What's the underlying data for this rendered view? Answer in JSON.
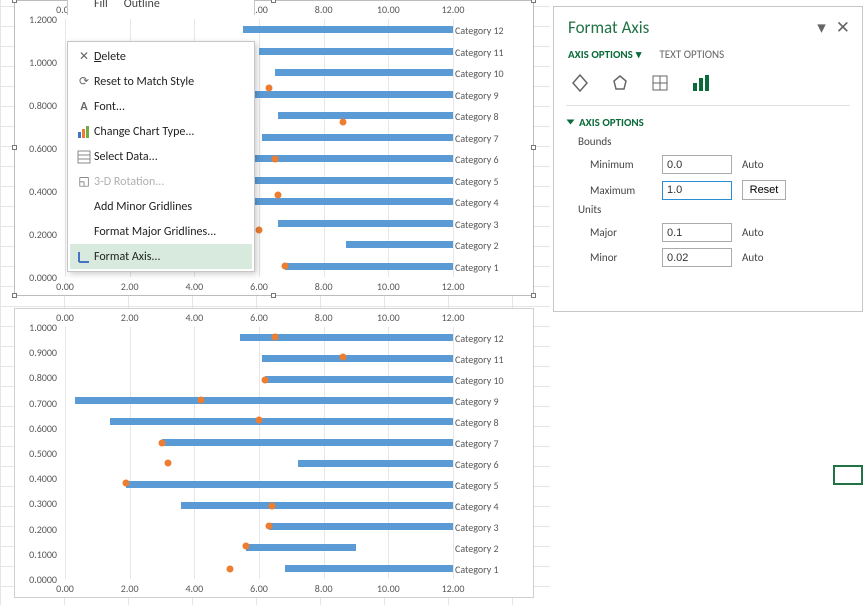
{
  "pane": {
    "title": "Format Axis",
    "tab_axis_options": "AXIS OPTIONS",
    "tab_text_options": "TEXT OPTIONS",
    "section": "AXIS OPTIONS",
    "bounds_label": "Bounds",
    "min_label": "Minimum",
    "min_value": "0.0",
    "min_btn": "Auto",
    "max_label": "Maximum",
    "max_value": "1.0",
    "max_btn": "Reset",
    "units_label": "Units",
    "major_label": "Major",
    "major_value": "0.1",
    "major_btn": "Auto",
    "minor_label": "Minor",
    "minor_value": "0.02",
    "minor_btn": "Auto"
  },
  "mini_toolbar": {
    "fill": "Fill",
    "outline": "Outline"
  },
  "context_menu": {
    "delete": "Delete",
    "reset": "Reset to Match Style",
    "font": "Font...",
    "change_type": "Change Chart Type...",
    "select_data": "Select Data...",
    "rotation": "3-D Rotation...",
    "add_minor": "Add Minor Gridlines",
    "format_major": "Format Major Gridlines...",
    "format_axis": "Format Axis..."
  },
  "chart_data": [
    {
      "type": "bar",
      "title": "",
      "xlabel": "",
      "ylabel": "",
      "x_range": [
        0,
        12
      ],
      "x_ticks": [
        0,
        2,
        4,
        6,
        8,
        10,
        12
      ],
      "x_tick_labels": [
        "0.00",
        "2.00",
        "4.00",
        "6.00",
        "8.00",
        "10.00",
        "12.00"
      ],
      "y_range": [
        0,
        1.2
      ],
      "y_ticks": [
        0,
        0.2,
        0.4,
        0.6,
        0.8,
        1.0,
        1.2
      ],
      "y_tick_labels": [
        "0.0000",
        "0.2000",
        "0.4000",
        "0.6000",
        "0.8000",
        "1.0000",
        "1.2000"
      ],
      "categories": [
        "Category 1",
        "Category 2",
        "Category 3",
        "Category 4",
        "Category 5",
        "Category 6",
        "Category 7",
        "Category 8",
        "Category 9",
        "Category 10",
        "Category 11",
        "Category 12"
      ],
      "bars": [
        {
          "start": 6.8,
          "end": 12.0
        },
        {
          "start": 8.7,
          "end": 12.0
        },
        {
          "start": 6.6,
          "end": 12.0
        },
        {
          "start": 5.8,
          "end": 12.0
        },
        {
          "start": 5.6,
          "end": 12.0
        },
        {
          "start": 5.4,
          "end": 12.0
        },
        {
          "start": 6.1,
          "end": 12.0
        },
        {
          "start": 6.6,
          "end": 12.0
        },
        {
          "start": 0.5,
          "end": 12.0
        },
        {
          "start": 6.5,
          "end": 12.0
        },
        {
          "start": 6.0,
          "end": 12.0
        },
        {
          "start": 5.5,
          "end": 12.0
        }
      ],
      "dots": [
        {
          "x": 6.8,
          "y": 0.05
        },
        {
          "x": 6.0,
          "y": 0.22
        },
        {
          "x": 6.6,
          "y": 0.38
        },
        {
          "x": 6.5,
          "y": 0.55
        },
        {
          "x": 8.6,
          "y": 0.72
        },
        {
          "x": 6.3,
          "y": 0.88
        }
      ]
    },
    {
      "type": "bar",
      "title": "",
      "xlabel": "",
      "ylabel": "",
      "x_range": [
        0,
        12
      ],
      "x_ticks": [
        0,
        2,
        4,
        6,
        8,
        10,
        12
      ],
      "x_tick_labels": [
        "0.00",
        "2.00",
        "4.00",
        "6.00",
        "8.00",
        "10.00",
        "12.00"
      ],
      "y_range": [
        0,
        1.0
      ],
      "y_ticks": [
        0,
        0.1,
        0.2,
        0.3,
        0.4,
        0.5,
        0.6,
        0.7,
        0.8,
        0.9,
        1.0
      ],
      "y_tick_labels": [
        "0.0000",
        "0.1000",
        "0.2000",
        "0.3000",
        "0.4000",
        "0.5000",
        "0.6000",
        "0.7000",
        "0.8000",
        "0.9000",
        "1.0000"
      ],
      "categories": [
        "Category 1",
        "Category 2",
        "Category 3",
        "Category 4",
        "Category 5",
        "Category 6",
        "Category 7",
        "Category 8",
        "Category 9",
        "Category 10",
        "Category 11",
        "Category 12"
      ],
      "bars": [
        {
          "start": 6.8,
          "end": 12.0
        },
        {
          "start": 5.6,
          "end": 9.0
        },
        {
          "start": 6.3,
          "end": 12.0
        },
        {
          "start": 3.6,
          "end": 12.0
        },
        {
          "start": 1.9,
          "end": 12.0
        },
        {
          "start": 7.2,
          "end": 12.0
        },
        {
          "start": 3.0,
          "end": 12.0
        },
        {
          "start": 1.4,
          "end": 12.0
        },
        {
          "start": 0.3,
          "end": 12.0
        },
        {
          "start": 6.2,
          "end": 12.0
        },
        {
          "start": 6.1,
          "end": 12.0
        },
        {
          "start": 5.4,
          "end": 12.0
        }
      ],
      "dots": [
        {
          "x": 5.1,
          "y": 0.04
        },
        {
          "x": 5.6,
          "y": 0.13
        },
        {
          "x": 6.3,
          "y": 0.21
        },
        {
          "x": 6.4,
          "y": 0.29
        },
        {
          "x": 1.9,
          "y": 0.38
        },
        {
          "x": 3.2,
          "y": 0.46
        },
        {
          "x": 3.0,
          "y": 0.54
        },
        {
          "x": 6.0,
          "y": 0.63
        },
        {
          "x": 4.2,
          "y": 0.71
        },
        {
          "x": 6.2,
          "y": 0.79
        },
        {
          "x": 8.6,
          "y": 0.88
        },
        {
          "x": 6.5,
          "y": 0.96
        }
      ]
    }
  ]
}
